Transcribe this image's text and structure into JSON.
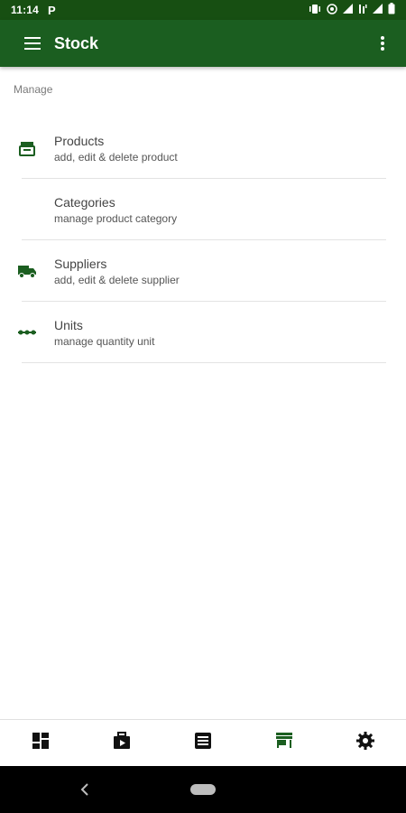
{
  "status_bar": {
    "time": "11:14",
    "badge": "P",
    "icons": [
      "vibrate-icon",
      "hotspot-icon",
      "signal-icon",
      "data-icon",
      "signal-icon",
      "battery-icon"
    ]
  },
  "app_bar": {
    "title": "Stock",
    "menu_icon": "menu-icon",
    "more_icon": "more-vert-icon"
  },
  "section": {
    "label": "Manage"
  },
  "list": {
    "items": [
      {
        "title": "Products",
        "subtitle": "add, edit & delete product",
        "icon": "store-icon"
      },
      {
        "title": "Categories",
        "subtitle": "manage product category",
        "icon": ""
      },
      {
        "title": "Suppliers",
        "subtitle": "add, edit & delete supplier",
        "icon": "truck-icon"
      },
      {
        "title": "Units",
        "subtitle": "manage quantity unit",
        "icon": "units-icon"
      }
    ]
  },
  "bottom_nav": {
    "items": [
      {
        "icon": "dashboard-icon",
        "active": false
      },
      {
        "icon": "sales-icon",
        "active": false
      },
      {
        "icon": "list-icon",
        "active": false
      },
      {
        "icon": "store-icon",
        "active": true
      },
      {
        "icon": "settings-icon",
        "active": false
      }
    ]
  },
  "colors": {
    "primary": "#1b5e20",
    "status_bar": "#174f12",
    "accent_icon": "#1b5e20",
    "inactive_icon": "#111111"
  }
}
